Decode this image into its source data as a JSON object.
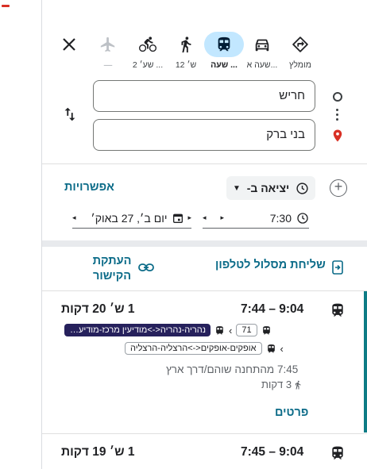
{
  "modes": [
    {
      "id": "best",
      "label": "מומלץ",
      "icon": "directions-icon"
    },
    {
      "id": "drive",
      "label": "שעה א...",
      "icon": "car-icon"
    },
    {
      "id": "transit",
      "label": "שעה ...",
      "icon": "bus-icon",
      "active": true
    },
    {
      "id": "walk",
      "label": "12 ש׳",
      "icon": "walk-icon"
    },
    {
      "id": "bike",
      "label": "2 שע׳ ...",
      "icon": "bike-icon"
    },
    {
      "id": "flight",
      "label": "—",
      "icon": "plane-icon",
      "disabled": true
    }
  ],
  "inputs": {
    "from": "חריש",
    "to": "בני ברק"
  },
  "options": {
    "options_label": "אפשרויות",
    "depart_label": "יציאה ב-",
    "time": "7:30",
    "date": "יום ב׳, 27 באוק׳"
  },
  "share": {
    "send_to_phone": "שליחת מסלול לטלפון",
    "copy_link_line1": "העתקת",
    "copy_link_line2": "הקישור"
  },
  "routes": [
    {
      "times": "7:44 – 9:04",
      "duration": "1 ש׳ 20 דקות",
      "line_name": "נהריה-נהריה<->מודיעין מרכז-מודיעין מ...",
      "line_number": "71",
      "line_color": "#26215c",
      "second_line": "אופקים-אופקים<->הרצליה-הרצליה",
      "departure_info": "7:45 מהתחנה שוהם/דרך ארץ",
      "walk_info": "3 דקות",
      "details_label": "פרטים"
    },
    {
      "times": "7:45 – 9:04",
      "duration": "1 ש׳ 19 דקות"
    }
  ],
  "colors": {
    "accent": "#0b6b88",
    "active_mode_bg": "#c2e7ff",
    "selected_route_bar": "#0e7c86",
    "destination_pin": "#d93025"
  }
}
